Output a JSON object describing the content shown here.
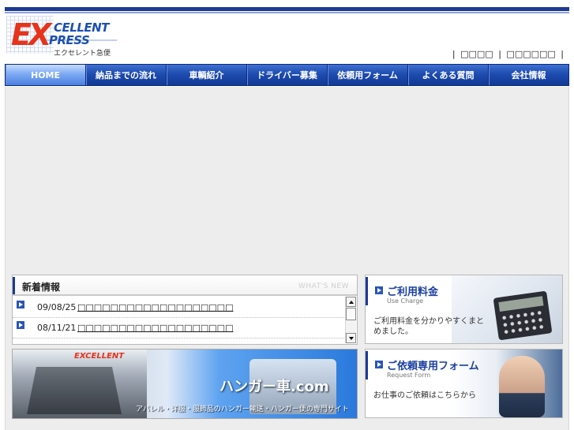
{
  "header": {
    "logo": {
      "main": "EX",
      "line1": "CELLENT",
      "line2": "PRESS",
      "jp": "エクセレント急便"
    },
    "top_links": [
      "□□□□",
      "□□□□□□"
    ],
    "separator": "|"
  },
  "nav": {
    "items": [
      {
        "label": "HOME"
      },
      {
        "label": "納品までの流れ"
      },
      {
        "label": "車輌紹介"
      },
      {
        "label": "ドライバー募集"
      },
      {
        "label": "依頼用フォーム"
      },
      {
        "label": "よくある質問"
      },
      {
        "label": "会社情報"
      }
    ],
    "active_index": 0
  },
  "news": {
    "title": "新着情報",
    "title_en": "WHAT'S NEW",
    "items": [
      {
        "date": "09/08/25",
        "text": "□□□□□□□□□□□□□□□□□□□"
      },
      {
        "date": "08/11/21",
        "text": "□□□□□□□□□□□□□□□□□□□"
      }
    ]
  },
  "banner": {
    "logo": "EXCELLENT",
    "title": "ハンガー車.com",
    "subtitle": "アパレル・洋服・服飾品のハンガー輸送・ハンガー便の専門サイト"
  },
  "cards": [
    {
      "title": "ご利用料金",
      "title_en": "Use Charge",
      "desc": "ご利用料金を分かりやすくまとめました。"
    },
    {
      "title": "ご依頼専用フォーム",
      "title_en": "Request Form",
      "desc": "お仕事のご依頼はこちらから"
    }
  ],
  "colors": {
    "brand_blue": "#1c3a93",
    "logo_red": "#e7331c",
    "nav_active": "#7eaaf3"
  }
}
